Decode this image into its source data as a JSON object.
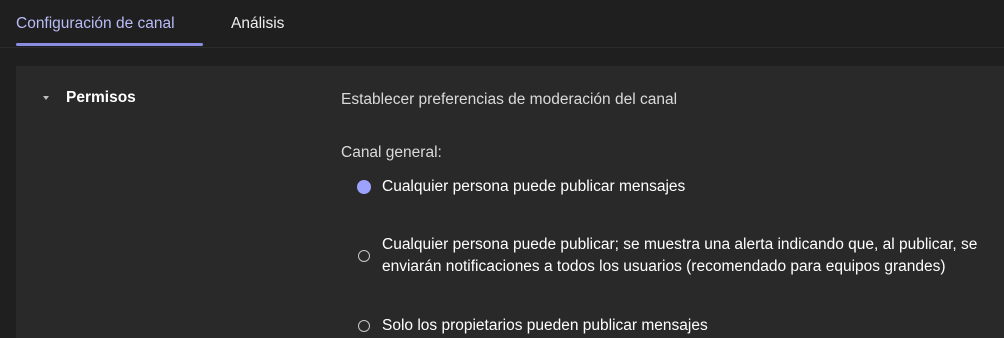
{
  "tabs": {
    "active": "Configuración de canal",
    "second": "Análisis"
  },
  "section": {
    "title": "Permisos"
  },
  "moderation": {
    "description": "Establecer preferencias de moderación del canal",
    "group_label": "Canal general:",
    "options": [
      {
        "label": "Cualquier persona puede publicar mensajes",
        "selected": true
      },
      {
        "label": "Cualquier persona puede publicar; se muestra una alerta indicando que, al publicar, se enviarán notificaciones a todos los usuarios (recomendado para equipos grandes)",
        "selected": false
      },
      {
        "label": "Solo los propietarios pueden publicar mensajes",
        "selected": false
      }
    ]
  },
  "colors": {
    "accent": "#9ea2ff",
    "active_tab_text": "#b9bcf7",
    "background": "#1f1f1f",
    "panel": "#292929"
  },
  "icons": {
    "section_toggle": "caret-down-icon",
    "selected_radio": "radio-checked-icon",
    "unselected_radio": "radio-unchecked-icon"
  }
}
